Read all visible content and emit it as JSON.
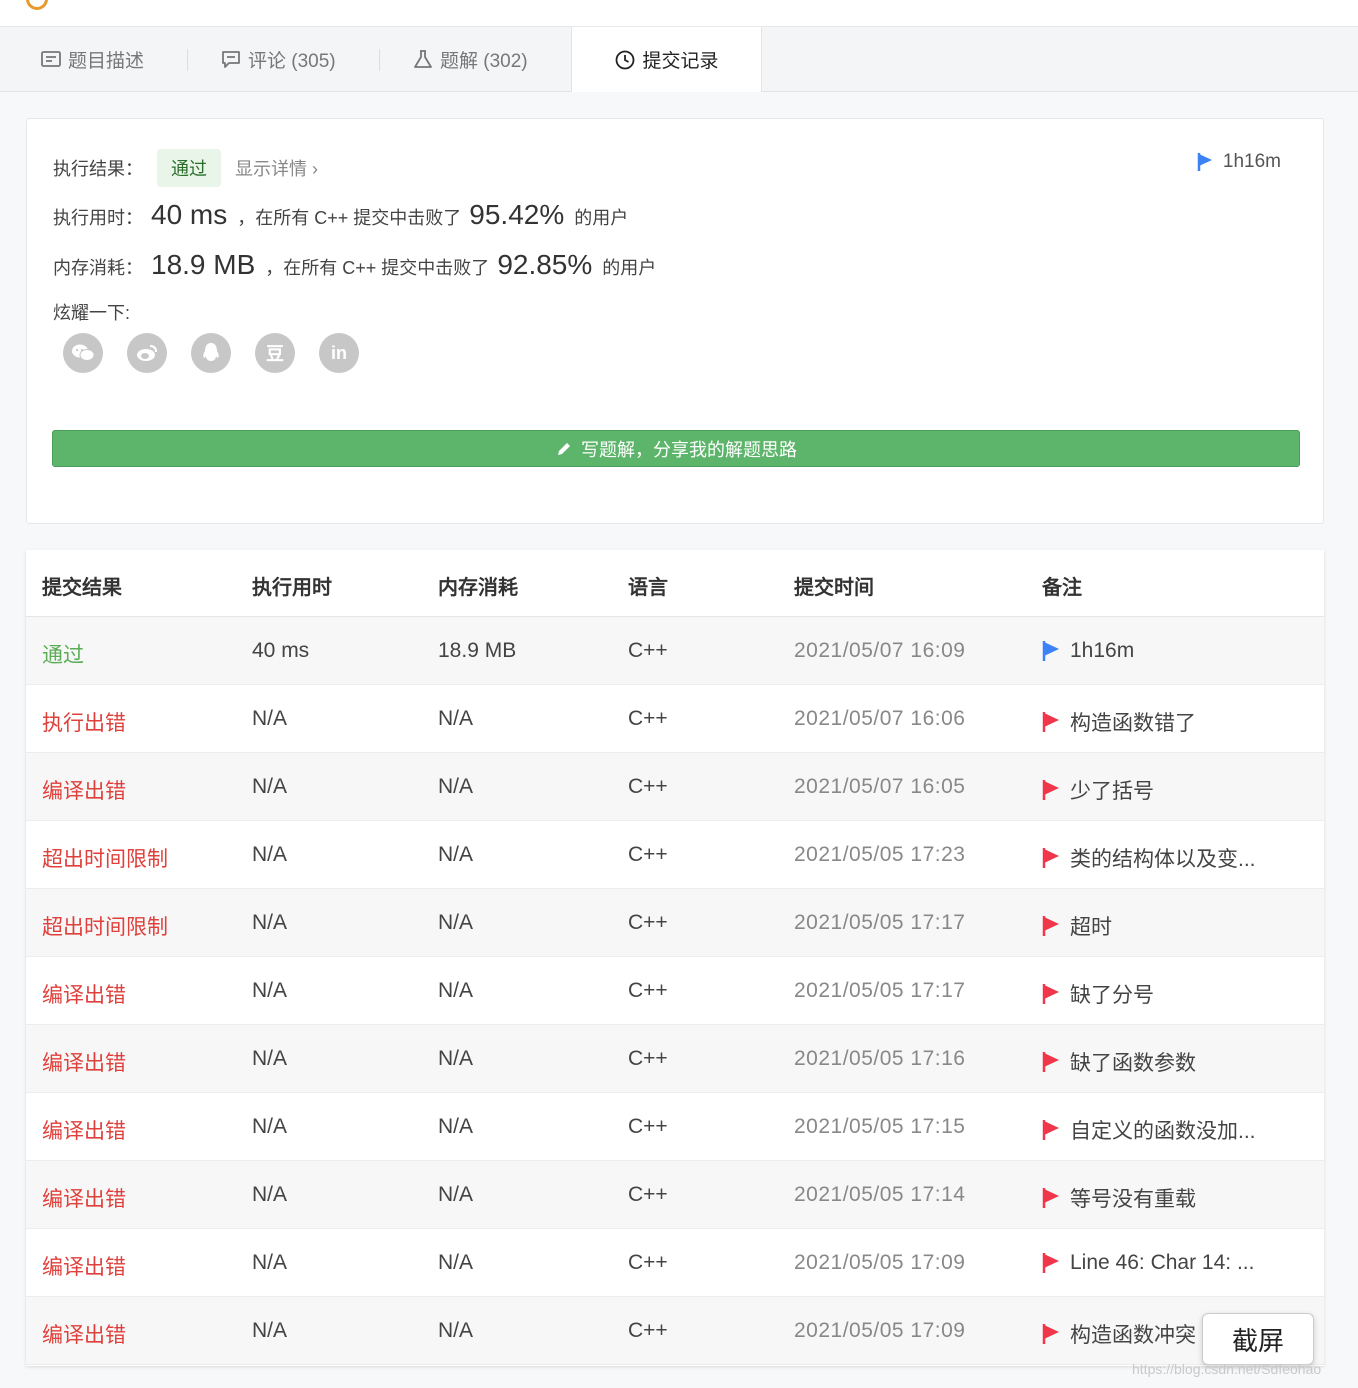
{
  "tabs": [
    {
      "label": "题目描述",
      "icon": "description-icon"
    },
    {
      "label": "评论 (305)",
      "icon": "comment-icon"
    },
    {
      "label": "题解 (302)",
      "icon": "flask-icon"
    },
    {
      "label": "提交记录",
      "icon": "clock-icon",
      "active": true
    }
  ],
  "result": {
    "status_label": "执行结果：",
    "status": "通过",
    "detail_link": "显示详情 ›",
    "elapsed": "1h16m",
    "runtime_label": "执行用时：",
    "runtime_value": "40 ms",
    "runtime_text": "，在所有 C++ 提交中击败了",
    "runtime_percent": "95.42%",
    "runtime_suffix": "的用户",
    "memory_label": "内存消耗：",
    "memory_value": "18.9 MB",
    "memory_text": "，在所有 C++ 提交中击败了",
    "memory_percent": "92.85%",
    "memory_suffix": "的用户",
    "share_label": "炫耀一下:",
    "share_icons": [
      "wechat-icon",
      "weibo-icon",
      "qq-icon",
      "douban-icon",
      "linkedin-icon"
    ],
    "douban_glyph": "豆",
    "linkedin_glyph": "in",
    "write_button": "写题解，分享我的解题思路"
  },
  "table": {
    "headers": [
      "提交结果",
      "执行用时",
      "内存消耗",
      "语言",
      "提交时间",
      "备注"
    ],
    "rows": [
      {
        "status": "通过",
        "kind": "pass",
        "runtime": "40 ms",
        "memory": "18.9 MB",
        "lang": "C++",
        "time": "2021/05/07 16:09",
        "note": "1h16m",
        "flag": "blue"
      },
      {
        "status": "执行出错",
        "kind": "err",
        "runtime": "N/A",
        "memory": "N/A",
        "lang": "C++",
        "time": "2021/05/07 16:06",
        "note": "构造函数错了",
        "flag": "red"
      },
      {
        "status": "编译出错",
        "kind": "err",
        "runtime": "N/A",
        "memory": "N/A",
        "lang": "C++",
        "time": "2021/05/07 16:05",
        "note": "少了括号",
        "flag": "red"
      },
      {
        "status": "超出时间限制",
        "kind": "err",
        "runtime": "N/A",
        "memory": "N/A",
        "lang": "C++",
        "time": "2021/05/05 17:23",
        "note": "类的结构体以及变...",
        "flag": "red"
      },
      {
        "status": "超出时间限制",
        "kind": "err",
        "runtime": "N/A",
        "memory": "N/A",
        "lang": "C++",
        "time": "2021/05/05 17:17",
        "note": "超时",
        "flag": "red"
      },
      {
        "status": "编译出错",
        "kind": "err",
        "runtime": "N/A",
        "memory": "N/A",
        "lang": "C++",
        "time": "2021/05/05 17:17",
        "note": "缺了分号",
        "flag": "red"
      },
      {
        "status": "编译出错",
        "kind": "err",
        "runtime": "N/A",
        "memory": "N/A",
        "lang": "C++",
        "time": "2021/05/05 17:16",
        "note": "缺了函数参数",
        "flag": "red"
      },
      {
        "status": "编译出错",
        "kind": "err",
        "runtime": "N/A",
        "memory": "N/A",
        "lang": "C++",
        "time": "2021/05/05 17:15",
        "note": "自定义的函数没加...",
        "flag": "red"
      },
      {
        "status": "编译出错",
        "kind": "err",
        "runtime": "N/A",
        "memory": "N/A",
        "lang": "C++",
        "time": "2021/05/05 17:14",
        "note": "等号没有重载",
        "flag": "red"
      },
      {
        "status": "编译出错",
        "kind": "err",
        "runtime": "N/A",
        "memory": "N/A",
        "lang": "C++",
        "time": "2021/05/05 17:09",
        "note": "Line 46: Char 14: ...",
        "flag": "red"
      },
      {
        "status": "编译出错",
        "kind": "err",
        "runtime": "N/A",
        "memory": "N/A",
        "lang": "C++",
        "time": "2021/05/05 17:09",
        "note": "构造函数冲突",
        "flag": "red"
      }
    ]
  },
  "overlay": {
    "screenshot_button": "截屏",
    "watermark": "https://blog.csdn.net/Sdfeohao"
  },
  "colors": {
    "pass": "#5aad55",
    "error": "#e0403b",
    "flag_blue": "#3b82f6",
    "flag_red": "#f0364a",
    "write_button": "#5cb56a"
  }
}
